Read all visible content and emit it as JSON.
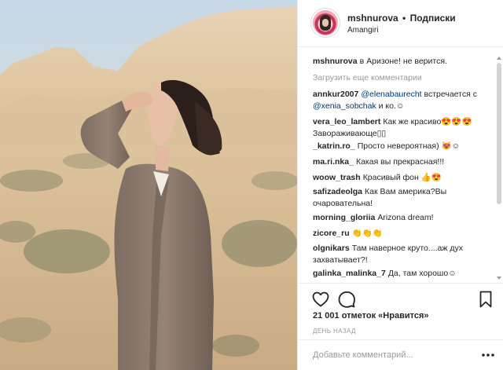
{
  "post": {
    "header": {
      "username": "mshnurova",
      "separator": "•",
      "follow_label": "Подписки",
      "location": "Amangiri"
    },
    "caption": {
      "user": "mshnurova",
      "text": "в Аризоне! не верится."
    },
    "load_more_label": "Загрузить еще комментарии",
    "comments": [
      {
        "user": "annkur2007",
        "mention1": "@elenabaurecht",
        "text1": " встречается с ",
        "mention2": "@xenia_sobchak",
        "text2": " и ко.☺"
      },
      {
        "user": "vera_leo_lambert",
        "text": "Как же красиво😍😍😍 Завораживающе▯▯"
      },
      {
        "user": "_katrin.ro_",
        "text": "Просто невероятная) 😻☺"
      },
      {
        "user": "ma.ri.nka_",
        "text": "Какая вы прекрасная!!!"
      },
      {
        "user": "woow_trash",
        "text": "Красивый фон 👍😍"
      },
      {
        "user": "safizadeolga",
        "text": "Как Вам америка?Вы очаровательна!"
      },
      {
        "user": "morning_gloriia",
        "text": "Arizona dream!"
      },
      {
        "user": "zicore_ru",
        "text": "👏👏👏"
      },
      {
        "user": "olgnikars",
        "text": "Там наверное круто....аж дух захватывает?!"
      },
      {
        "user": "galinka_malinka_7",
        "text": "Да, там хорошо☺"
      }
    ],
    "likes_text": "21 001 отметок «Нравится»",
    "timestamp": "ДЕНЬ НАЗАД",
    "comment_placeholder": "Добавьте комментарий..."
  },
  "icons": {
    "like": "heart-icon",
    "comment": "comment-icon",
    "save": "bookmark-icon",
    "options": "more-icon"
  },
  "colors": {
    "text": "#262626",
    "muted": "#999999",
    "mention": "#003569",
    "border": "#efefef"
  }
}
